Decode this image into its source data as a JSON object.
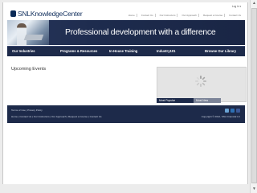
{
  "header": {
    "logo_text": "SNLKnowledgeCenter",
    "login_label": "Log in",
    "top_links": [
      "Home",
      "Contact Us",
      "Our Instructors",
      "Our Approach",
      "Request a Course",
      "Contact Us"
    ]
  },
  "banner": {
    "tagline": "Professional development with a difference"
  },
  "nav": {
    "items": [
      "Our Industries",
      "Programs & Resources",
      "In-House Training",
      "Industry101",
      "Browse Our Library"
    ]
  },
  "main": {
    "heading": "Upcoming Events"
  },
  "widget": {
    "tabs": [
      "Most Popular",
      "Most New"
    ]
  },
  "footer": {
    "line1": "Terms of Use | Privacy Policy",
    "line2": "Home | Contact Us | Our Instructors | Our Approach | Request a Course | Contact Us",
    "copyright": "Copyright © 2012, SNL Financial LC"
  },
  "colors": {
    "navy": "#1d2a4a",
    "banner": "#27355a",
    "twitter": "#6aa3d4",
    "linkedin": "#2d6fb3",
    "facebook": "#3b5998"
  },
  "icons": {
    "spinner": "loading-spinner-icon",
    "social": [
      "twitter-icon",
      "linkedin-icon",
      "facebook-icon"
    ]
  }
}
